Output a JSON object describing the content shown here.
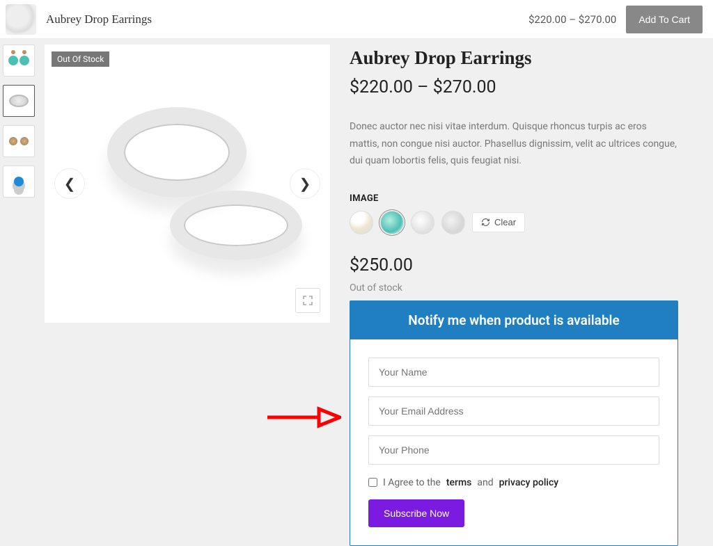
{
  "topbar": {
    "title": "Aubrey Drop Earrings",
    "price_range": "$220.00 – $270.00",
    "add_to_cart": "Add To Cart"
  },
  "gallery": {
    "badge": "Out Of Stock"
  },
  "product": {
    "title": "Aubrey Drop Earrings",
    "price_range": "$220.00 – $270.00",
    "description": "Donec auctor nec nisi vitae interdum. Quisque rhoncus turpis ac eros mattis, non congue nisi auctor. Phasellus dignissim, velit ac ultrices congue, dui quam lobortis felis, quis feugiat nisi.",
    "attr_label": "IMAGE",
    "clear_label": "Clear",
    "selected_price": "$250.00",
    "stock_msg": "Out of stock"
  },
  "notify": {
    "title": "Notify me when product is available",
    "name_ph": "Your Name",
    "email_ph": "Your Email Address",
    "phone_ph": "Your Phone",
    "consent_pre": "I Agree to the",
    "terms": "terms",
    "and": "and",
    "privacy": "privacy policy",
    "subscribe": "Subscribe Now"
  }
}
